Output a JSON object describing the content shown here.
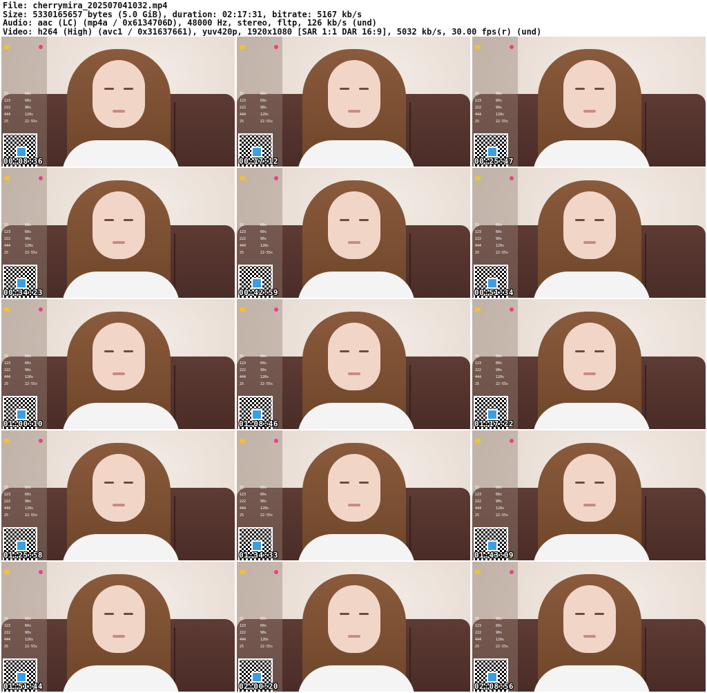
{
  "header": {
    "file": "File: cherrymira_202507041032.mp4",
    "size": "Size: 5330165657 bytes (5.0 GiB), duration: 02:17:31, bitrate: 5167 kb/s",
    "audio": "Audio: aac (LC) (mp4a / 0x6134706D), 48000 Hz, stereo, fltp, 126 kb/s (und)",
    "video": "Video: h264 (High) (avc1 / 0x31637661), yuv420p, 1920x1080 [SAR 1:1 DAR 16:9], 5032 kb/s, 30.00 fps(r) (und)"
  },
  "thumbnails": [
    {
      "timestamp": "00:08:36"
    },
    {
      "timestamp": "00:17:12"
    },
    {
      "timestamp": "00:25:47"
    },
    {
      "timestamp": "00:34:23"
    },
    {
      "timestamp": "00:42:59"
    },
    {
      "timestamp": "00:51:34"
    },
    {
      "timestamp": "01:00:10"
    },
    {
      "timestamp": "01:08:46"
    },
    {
      "timestamp": "01:17:22"
    },
    {
      "timestamp": "01:25:58"
    },
    {
      "timestamp": "01:34:33"
    },
    {
      "timestamp": "01:43:09"
    },
    {
      "timestamp": "01:51:44"
    },
    {
      "timestamp": "02:00:20"
    },
    {
      "timestamp": "02:08:56"
    }
  ],
  "overlay_menu": [
    {
      "range": "55",
      "value": "60s"
    },
    {
      "range": "123",
      "value": "60s"
    },
    {
      "range": "222",
      "value": "90s"
    },
    {
      "range": "444",
      "value": "120s"
    },
    {
      "range": "25",
      "value": "22-55s"
    }
  ],
  "colors": {
    "accent": "#ee3d8a",
    "couch": "#4a2c27",
    "hair": "#7a4e33"
  }
}
